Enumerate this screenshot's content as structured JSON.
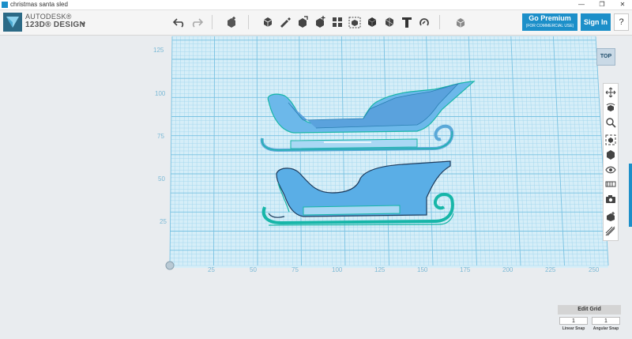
{
  "window": {
    "title": "christmas santa sled",
    "controls": [
      "—",
      "❐",
      "✕"
    ]
  },
  "brand": {
    "line1": "AUTODESK®",
    "line2": "123D® DESIGN"
  },
  "toolbar": {
    "tools": [
      {
        "name": "undo-icon"
      },
      {
        "name": "redo-icon"
      },
      {
        "name": "transform-icon"
      },
      {
        "name": "primitives-icon"
      },
      {
        "name": "sketch-icon"
      },
      {
        "name": "construct-icon"
      },
      {
        "name": "modify-icon"
      },
      {
        "name": "pattern-icon"
      },
      {
        "name": "group-icon"
      },
      {
        "name": "combine-icon"
      },
      {
        "name": "measure-icon"
      },
      {
        "name": "text-icon"
      },
      {
        "name": "snap-icon"
      },
      {
        "name": "material-icon"
      }
    ],
    "premium_label": "Go Premium",
    "premium_sub": "(FOR COMMERCIAL USE)",
    "signin_label": "Sign In",
    "help_label": "?"
  },
  "viewcube": {
    "label": "TOP"
  },
  "grid": {
    "y_ticks": [
      "125",
      "100",
      "75",
      "50",
      "25"
    ],
    "x_ticks": [
      "25",
      "50",
      "75",
      "100",
      "125",
      "150",
      "175",
      "200",
      "225",
      "250"
    ],
    "grid_color": "#7fc6e4",
    "floor_color": "#d6eef8",
    "label_color": "#7ab9d6"
  },
  "navigation": {
    "icons": [
      "pan-icon",
      "orbit-icon",
      "zoom-icon",
      "fit-icon",
      "view-icon",
      "visibility-icon",
      "materials-icon",
      "screenshot-icon",
      "snap-view-icon",
      "outline-icon"
    ]
  },
  "grid_panel": {
    "title": "Edit Grid",
    "linear_snap_value": "1",
    "angular_snap_value": "1",
    "linear_snap_label": "Linear Snap",
    "angular_snap_label": "Angular Snap"
  },
  "colors": {
    "accent": "#1c8fc9",
    "model_fill": "#6cb8ea",
    "model_edge": "#17b6a8"
  }
}
